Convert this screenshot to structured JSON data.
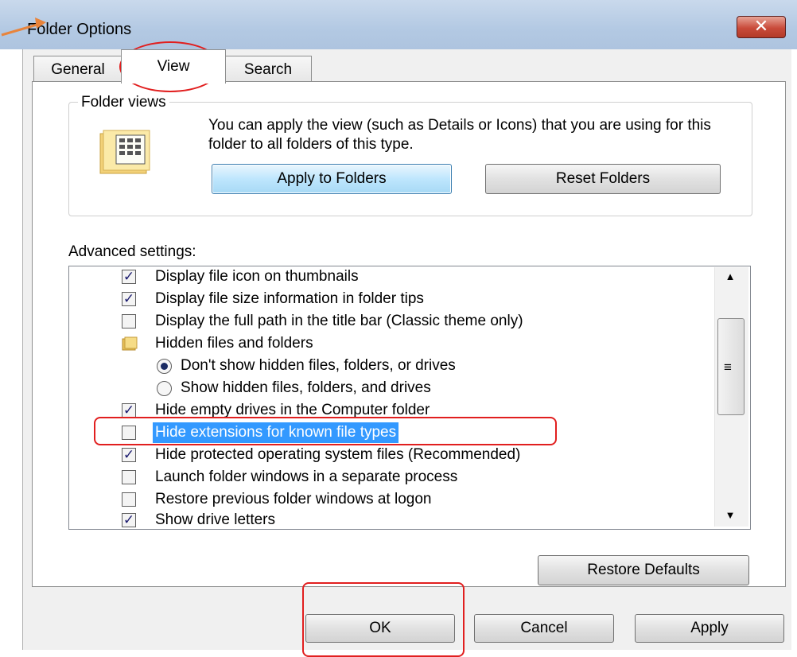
{
  "window": {
    "title": "Folder Options",
    "close_glyph": "✕"
  },
  "tabs": [
    {
      "label": "General",
      "active": false
    },
    {
      "label": "View",
      "active": true
    },
    {
      "label": "Search",
      "active": false
    }
  ],
  "folder_views": {
    "group_label": "Folder views",
    "description": "You can apply the view (such as Details or Icons) that you are using for this folder to all folders of this type.",
    "icon": "folder-view-icon",
    "apply_button": "Apply to Folders",
    "reset_button": "Reset Folders"
  },
  "advanced": {
    "label": "Advanced settings:",
    "items": [
      {
        "kind": "checkbox",
        "checked": true,
        "label": "Display file icon on thumbnails"
      },
      {
        "kind": "checkbox",
        "checked": true,
        "label": "Display file size information in folder tips"
      },
      {
        "kind": "checkbox",
        "checked": false,
        "label": "Display the full path in the title bar (Classic theme only)"
      },
      {
        "kind": "folder",
        "label": "Hidden files and folders"
      },
      {
        "kind": "radio",
        "checked": true,
        "label": "Don't show hidden files, folders, or drives"
      },
      {
        "kind": "radio",
        "checked": false,
        "label": "Show hidden files, folders, and drives"
      },
      {
        "kind": "checkbox",
        "checked": true,
        "label": "Hide empty drives in the Computer folder"
      },
      {
        "kind": "checkbox",
        "checked": false,
        "label": "Hide extensions for known file types",
        "selected": true
      },
      {
        "kind": "checkbox",
        "checked": true,
        "label": "Hide protected operating system files (Recommended)"
      },
      {
        "kind": "checkbox",
        "checked": false,
        "label": "Launch folder windows in a separate process"
      },
      {
        "kind": "checkbox",
        "checked": false,
        "label": "Restore previous folder windows at logon"
      },
      {
        "kind": "checkbox",
        "checked": true,
        "label": "Show drive letters"
      }
    ],
    "restore_button": "Restore Defaults"
  },
  "footer": {
    "ok_button": "OK",
    "cancel_button": "Cancel",
    "apply_button": "Apply"
  },
  "colors": {
    "selection": "#3399ff",
    "annotation_red": "#e11f1f",
    "annotation_arrow": "#e8843c"
  }
}
